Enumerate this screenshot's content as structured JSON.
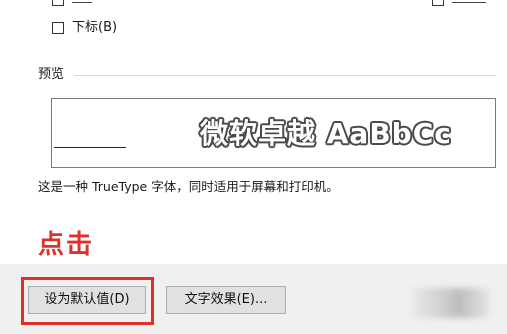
{
  "options": {
    "subscript_label": "下标(B)"
  },
  "preview": {
    "section_label": "预览",
    "sample_text": "微软卓越 AaBbCc",
    "description": "这是一种 TrueType 字体，同时适用于屏幕和打印机。"
  },
  "annotation": {
    "text": "点击",
    "color": "#e0302a"
  },
  "buttons": {
    "set_default_label": "设为默认值(D)",
    "text_effects_label": "文字效果(E)..."
  }
}
